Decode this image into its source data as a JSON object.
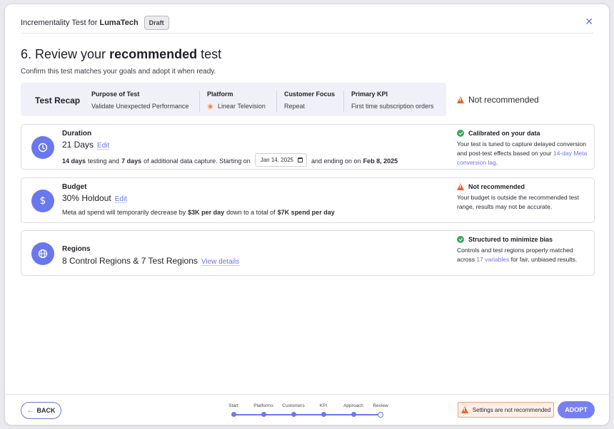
{
  "header": {
    "title_prefix": "Incrementality Test for",
    "title_brand": "LumaTech",
    "status_badge": "Draft"
  },
  "page": {
    "heading_prefix": "6. Review your",
    "heading_bold": "recommended",
    "heading_suffix": "test",
    "subtitle": "Confirm this test matches your goals and adopt it when ready."
  },
  "recap": {
    "title": "Test Recap",
    "columns": [
      {
        "label": "Purpose of Test",
        "value": "Validate Unexpected Performance"
      },
      {
        "label": "Platform",
        "value": "Linear Television"
      },
      {
        "label": "Customer Focus",
        "value": "Repeat"
      },
      {
        "label": "Primary KPI",
        "value": "First time subscription orders"
      }
    ],
    "status": "Not recommended"
  },
  "cards": {
    "duration": {
      "title": "Duration",
      "value": "21 Days",
      "edit": "Edit",
      "d1": "14 days",
      "d2": "testing and",
      "d3": "7 days",
      "d4": "of additional data capture. Starting on",
      "start_date": "Jan 14, 2025",
      "d5": "and ending on on",
      "end_date": "Feb 8, 2025",
      "side_title": "Calibrated on your data",
      "side_text": "Your test is tuned to capture delayed conversion and post-test effects based on your",
      "side_link": "14-day Meta conversion lag",
      "side_end": "."
    },
    "budget": {
      "title": "Budget",
      "value": "30% Holdout",
      "edit": "Edit",
      "d1": "Meta ad spend will temporarily decrease by",
      "d2": "$3K per day",
      "d3": "down to a total of",
      "d4": "$7K spend per day",
      "side_title": "Not recommended",
      "side_text": "Your budget is outside the recommended test range, results may not be accurate."
    },
    "regions": {
      "title": "Regions",
      "value": "8 Control Regions & 7 Test Regions",
      "link": "View details",
      "side_title": "Structured to minimize bias",
      "side_text": "Controls and test regions properly matched across",
      "side_link": "17 variables",
      "side_end": "for fair, unbiased results."
    }
  },
  "footer": {
    "back": "BACK",
    "steps": [
      "Start",
      "Platforms",
      "Customers",
      "KPI",
      "Approach",
      "Review"
    ],
    "current_step": "Review",
    "warning": "Settings are not recommended",
    "adopt": "ADOPT"
  }
}
